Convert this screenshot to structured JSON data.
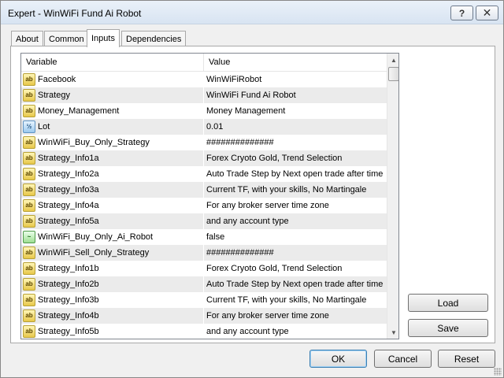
{
  "window": {
    "title": "Expert - WinWiFi Fund Ai Robot",
    "help_label": "?",
    "close_label": "✕"
  },
  "tabs": [
    {
      "label": "About",
      "active": false
    },
    {
      "label": "Common",
      "active": false
    },
    {
      "label": "Inputs",
      "active": true
    },
    {
      "label": "Dependencies",
      "active": false
    }
  ],
  "grid": {
    "columns": {
      "variable": "Variable",
      "value": "Value"
    },
    "rows": [
      {
        "type": "string",
        "icon": "string-icon",
        "icon_text": "ab",
        "name": "Facebook",
        "value": "WinWiFiRobot"
      },
      {
        "type": "string",
        "icon": "string-icon",
        "icon_text": "ab",
        "name": "Strategy",
        "value": "WinWiFi Fund Ai Robot"
      },
      {
        "type": "string",
        "icon": "string-icon",
        "icon_text": "ab",
        "name": "Money_Management",
        "value": "Money Management"
      },
      {
        "type": "number",
        "icon": "double-icon",
        "icon_text": "½",
        "name": "Lot",
        "value": "0.01"
      },
      {
        "type": "string",
        "icon": "string-icon",
        "icon_text": "ab",
        "name": "WinWiFi_Buy_Only_Strategy",
        "value": "##############"
      },
      {
        "type": "string",
        "icon": "string-icon",
        "icon_text": "ab",
        "name": "Strategy_Info1a",
        "value": "Forex Cryoto Gold, Trend Selection"
      },
      {
        "type": "string",
        "icon": "string-icon",
        "icon_text": "ab",
        "name": "Strategy_Info2a",
        "value": "Auto Trade Step by Next open trade after time"
      },
      {
        "type": "string",
        "icon": "string-icon",
        "icon_text": "ab",
        "name": "Strategy_Info3a",
        "value": "Current TF, with your skills, No Martingale"
      },
      {
        "type": "string",
        "icon": "string-icon",
        "icon_text": "ab",
        "name": "Strategy_Info4a",
        "value": "For any broker server time zone"
      },
      {
        "type": "string",
        "icon": "string-icon",
        "icon_text": "ab",
        "name": "Strategy_Info5a",
        "value": "and any account type"
      },
      {
        "type": "bool",
        "icon": "bool-icon",
        "icon_text": "~",
        "name": "WinWiFi_Buy_Only_Ai_Robot",
        "value": "false"
      },
      {
        "type": "string",
        "icon": "string-icon",
        "icon_text": "ab",
        "name": "WinWiFi_Sell_Only_Strategy",
        "value": "##############"
      },
      {
        "type": "string",
        "icon": "string-icon",
        "icon_text": "ab",
        "name": "Strategy_Info1b",
        "value": "Forex Cryoto Gold, Trend Selection"
      },
      {
        "type": "string",
        "icon": "string-icon",
        "icon_text": "ab",
        "name": "Strategy_Info2b",
        "value": "Auto Trade Step by Next open trade after time"
      },
      {
        "type": "string",
        "icon": "string-icon",
        "icon_text": "ab",
        "name": "Strategy_Info3b",
        "value": "Current TF, with your skills, No Martingale"
      },
      {
        "type": "string",
        "icon": "string-icon",
        "icon_text": "ab",
        "name": "Strategy_Info4b",
        "value": "For any broker server time zone"
      },
      {
        "type": "string",
        "icon": "string-icon",
        "icon_text": "ab",
        "name": "Strategy_Info5b",
        "value": "and any account type"
      }
    ]
  },
  "side_buttons": {
    "load": "Load",
    "save": "Save"
  },
  "footer_buttons": {
    "ok": "OK",
    "cancel": "Cancel",
    "reset": "Reset"
  },
  "scrollbar": {
    "up_icon": "▲",
    "down_icon": "▼"
  }
}
